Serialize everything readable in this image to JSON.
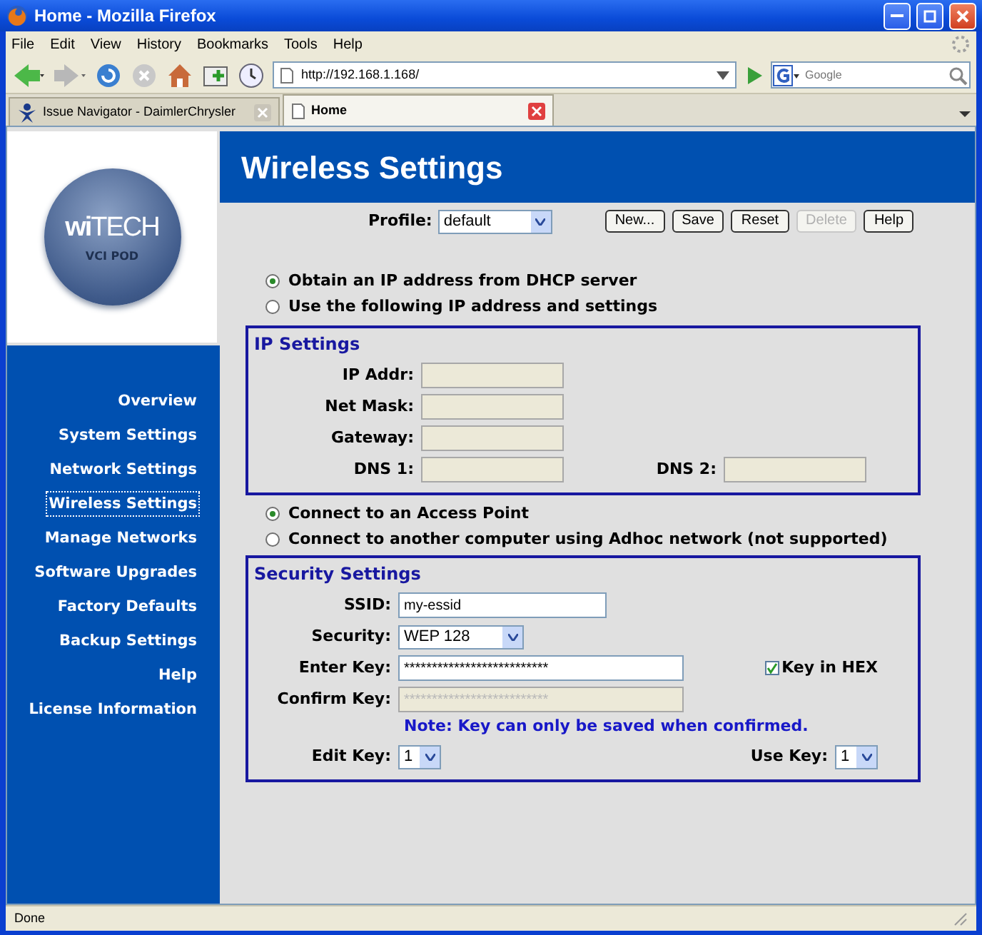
{
  "window": {
    "title": "Home - Mozilla Firefox"
  },
  "menu": [
    "File",
    "Edit",
    "View",
    "History",
    "Bookmarks",
    "Tools",
    "Help"
  ],
  "address": {
    "url": "http://192.168.1.168/"
  },
  "search": {
    "placeholder": "Google"
  },
  "tabs": [
    {
      "label": "Issue Navigator - DaimlerChrysler",
      "selected": false
    },
    {
      "label": "Home",
      "selected": true
    }
  ],
  "logo": {
    "brand": "**wi**TECH",
    "sub": "VCI POD"
  },
  "sidebar": {
    "items": [
      {
        "label": "Overview",
        "selected": false
      },
      {
        "label": "System Settings",
        "selected": false
      },
      {
        "label": "Network Settings",
        "selected": false
      },
      {
        "label": "Wireless Settings",
        "selected": true
      },
      {
        "label": "Manage Networks",
        "selected": false
      },
      {
        "label": "Software Upgrades",
        "selected": false
      },
      {
        "label": "Factory Defaults",
        "selected": false
      },
      {
        "label": "Backup Settings",
        "selected": false
      },
      {
        "label": "Help",
        "selected": false
      },
      {
        "label": "License Information",
        "selected": false
      }
    ]
  },
  "page_title": "Wireless Settings",
  "profile": {
    "label": "Profile:",
    "value": "default"
  },
  "buttons": [
    {
      "label": "New...",
      "disabled": false
    },
    {
      "label": "Save",
      "disabled": false
    },
    {
      "label": "Reset",
      "disabled": false
    },
    {
      "label": "Delete",
      "disabled": true
    },
    {
      "label": "Help",
      "disabled": false
    }
  ],
  "ip_mode": [
    {
      "label": "Obtain an IP address from DHCP server",
      "selected": true
    },
    {
      "label": "Use the following IP address and settings",
      "selected": false
    }
  ],
  "ip_settings": {
    "title": "IP Settings",
    "fields": [
      {
        "label": "IP Addr:"
      },
      {
        "label": "Net Mask:"
      },
      {
        "label": "Gateway:"
      }
    ],
    "dns": [
      {
        "label": "DNS 1:"
      },
      {
        "label": "DNS 2:"
      }
    ]
  },
  "connect_mode": [
    {
      "label": "Connect to an Access Point",
      "selected": true
    },
    {
      "label": "Connect to another computer using Adhoc network (not supported)",
      "selected": false
    }
  ],
  "security_settings": {
    "title": "Security Settings",
    "ssid": {
      "label": "SSID:",
      "value": "my-essid"
    },
    "security": {
      "label": "Security:",
      "value": "WEP 128"
    },
    "enter_key": {
      "label": "Enter Key:",
      "value": "**************************",
      "disabled": false
    },
    "confirm_key": {
      "label": "Confirm Key:",
      "value": "**************************",
      "disabled": true
    },
    "key_in_hex": {
      "label": "Key in HEX",
      "checked": true
    },
    "note": "Note: Key can only be saved when confirmed.",
    "edit_key": {
      "label": "Edit Key:",
      "value": "1"
    },
    "use_key": {
      "label": "Use Key:",
      "value": "1"
    }
  },
  "status_bar": "Done"
}
